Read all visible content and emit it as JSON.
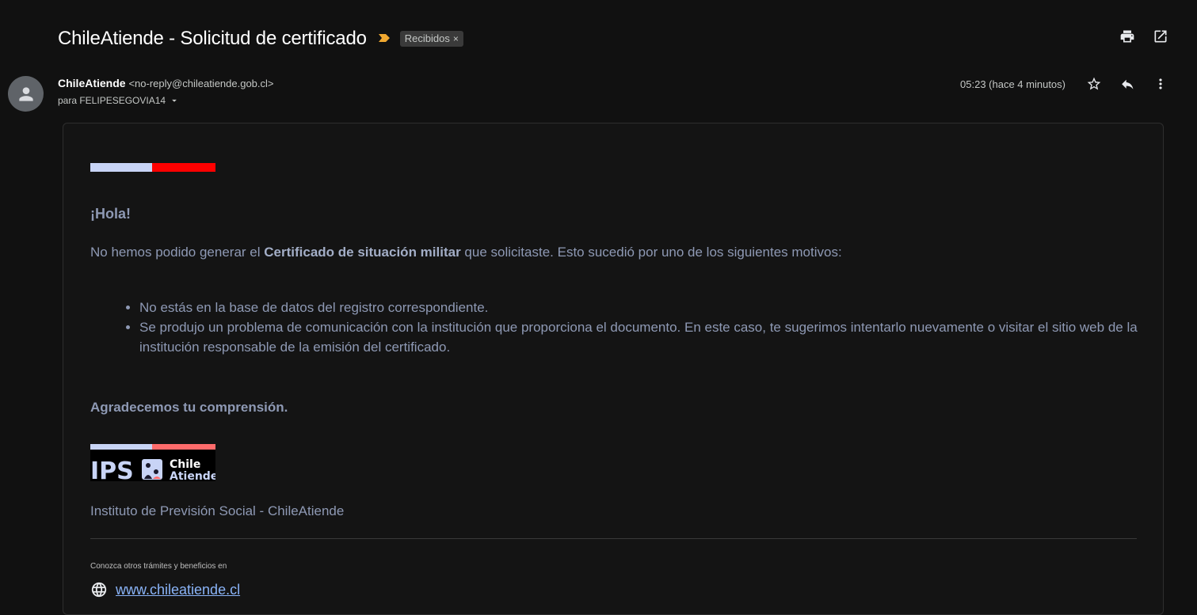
{
  "subject": "ChileAtiende - Solicitud de certificado",
  "label": "Recibidos",
  "label_remove": "×",
  "sender": {
    "name": "ChileAtiende",
    "email": "<no-reply@chileatiende.gob.cl>",
    "to": "para FELIPESEGOVIA14"
  },
  "time": "05:23 (hace 4 minutos)",
  "colors": {
    "background": "#111111",
    "body_text": "#8e99b4",
    "link": "#8ab4f8",
    "flag_blue": "#c8d4f6",
    "flag_red": "#ff0000",
    "marker": "#f0a830"
  },
  "body": {
    "greeting": "¡Hola!",
    "para_before": "No hemos podido generar el ",
    "para_bold": "Certificado de situación militar",
    "para_after": " que solicitaste. Esto sucedió por uno de los siguientes motivos:",
    "reasons": [
      "No estás en la base de datos del registro correspondiente.",
      "Se produjo un problema de comunicación con la institución que proporciona el documento. En este caso, te sugerimos intentarlo nuevamente o visitar el sitio web de la institución responsable de la emisión del certificado."
    ],
    "thanks": "Agradecemos tu comprensión.",
    "logo_ips": "IPS",
    "logo_chile": "Chile",
    "logo_atiende": "Atiende",
    "institution": "Instituto de Previsión Social - ChileAtiende",
    "footer_note": "Conozca otros trámites y beneficios en",
    "site_link": "www.chileatiende.cl"
  },
  "icons": [
    "important-marker-icon",
    "print-icon",
    "open-new-window-icon",
    "avatar-person-icon",
    "dropdown-arrow-icon",
    "star-icon",
    "reply-icon",
    "more-vert-icon",
    "globe-icon"
  ]
}
